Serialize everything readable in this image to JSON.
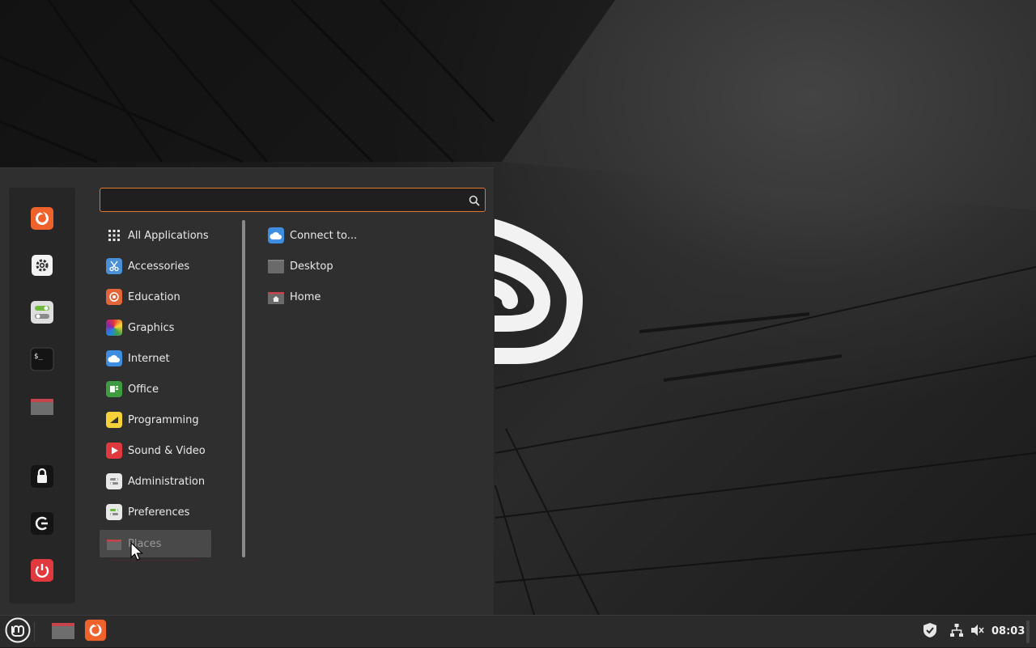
{
  "search": {
    "value": "",
    "placeholder": ""
  },
  "favorites": [
    {
      "name": "Firefox",
      "icon": "firefox-icon"
    },
    {
      "name": "System Settings",
      "icon": "gear-icon"
    },
    {
      "name": "Control Center",
      "icon": "toggles-icon"
    },
    {
      "name": "Terminal",
      "icon": "terminal-icon"
    },
    {
      "name": "Files",
      "icon": "folder-icon"
    }
  ],
  "session": [
    {
      "name": "Lock Screen",
      "icon": "lock-icon"
    },
    {
      "name": "Log Out",
      "icon": "logout-icon"
    },
    {
      "name": "Quit",
      "icon": "power-icon"
    }
  ],
  "categories": [
    {
      "label": "All Applications",
      "icon": "grid-icon"
    },
    {
      "label": "Accessories",
      "icon": "scissors-icon"
    },
    {
      "label": "Education",
      "icon": "education-icon"
    },
    {
      "label": "Graphics",
      "icon": "graphics-icon"
    },
    {
      "label": "Internet",
      "icon": "cloud-icon"
    },
    {
      "label": "Office",
      "icon": "office-icon"
    },
    {
      "label": "Programming",
      "icon": "programming-icon"
    },
    {
      "label": "Sound & Video",
      "icon": "play-icon"
    },
    {
      "label": "Administration",
      "icon": "admin-icon"
    },
    {
      "label": "Preferences",
      "icon": "preferences-icon"
    },
    {
      "label": "Places",
      "icon": "folder-icon"
    }
  ],
  "selected_category": "Places",
  "places": [
    {
      "label": "Connect to...",
      "icon": "cloud-icon"
    },
    {
      "label": "Desktop",
      "icon": "desktop-folder-icon"
    },
    {
      "label": "Home",
      "icon": "home-folder-icon"
    }
  ],
  "panel": {
    "clock": "08:03",
    "launchers": [
      "folder-icon",
      "firefox-icon"
    ],
    "tray_icons": [
      "shield-icon",
      "network-icon",
      "volume-muted-icon"
    ]
  },
  "colors": {
    "accent": "#e2782b",
    "menu_bg": "#2f2f2f",
    "panel_bg": "#2b2b2b",
    "folder_red": "#c8424b",
    "power_red": "#e0393e"
  }
}
